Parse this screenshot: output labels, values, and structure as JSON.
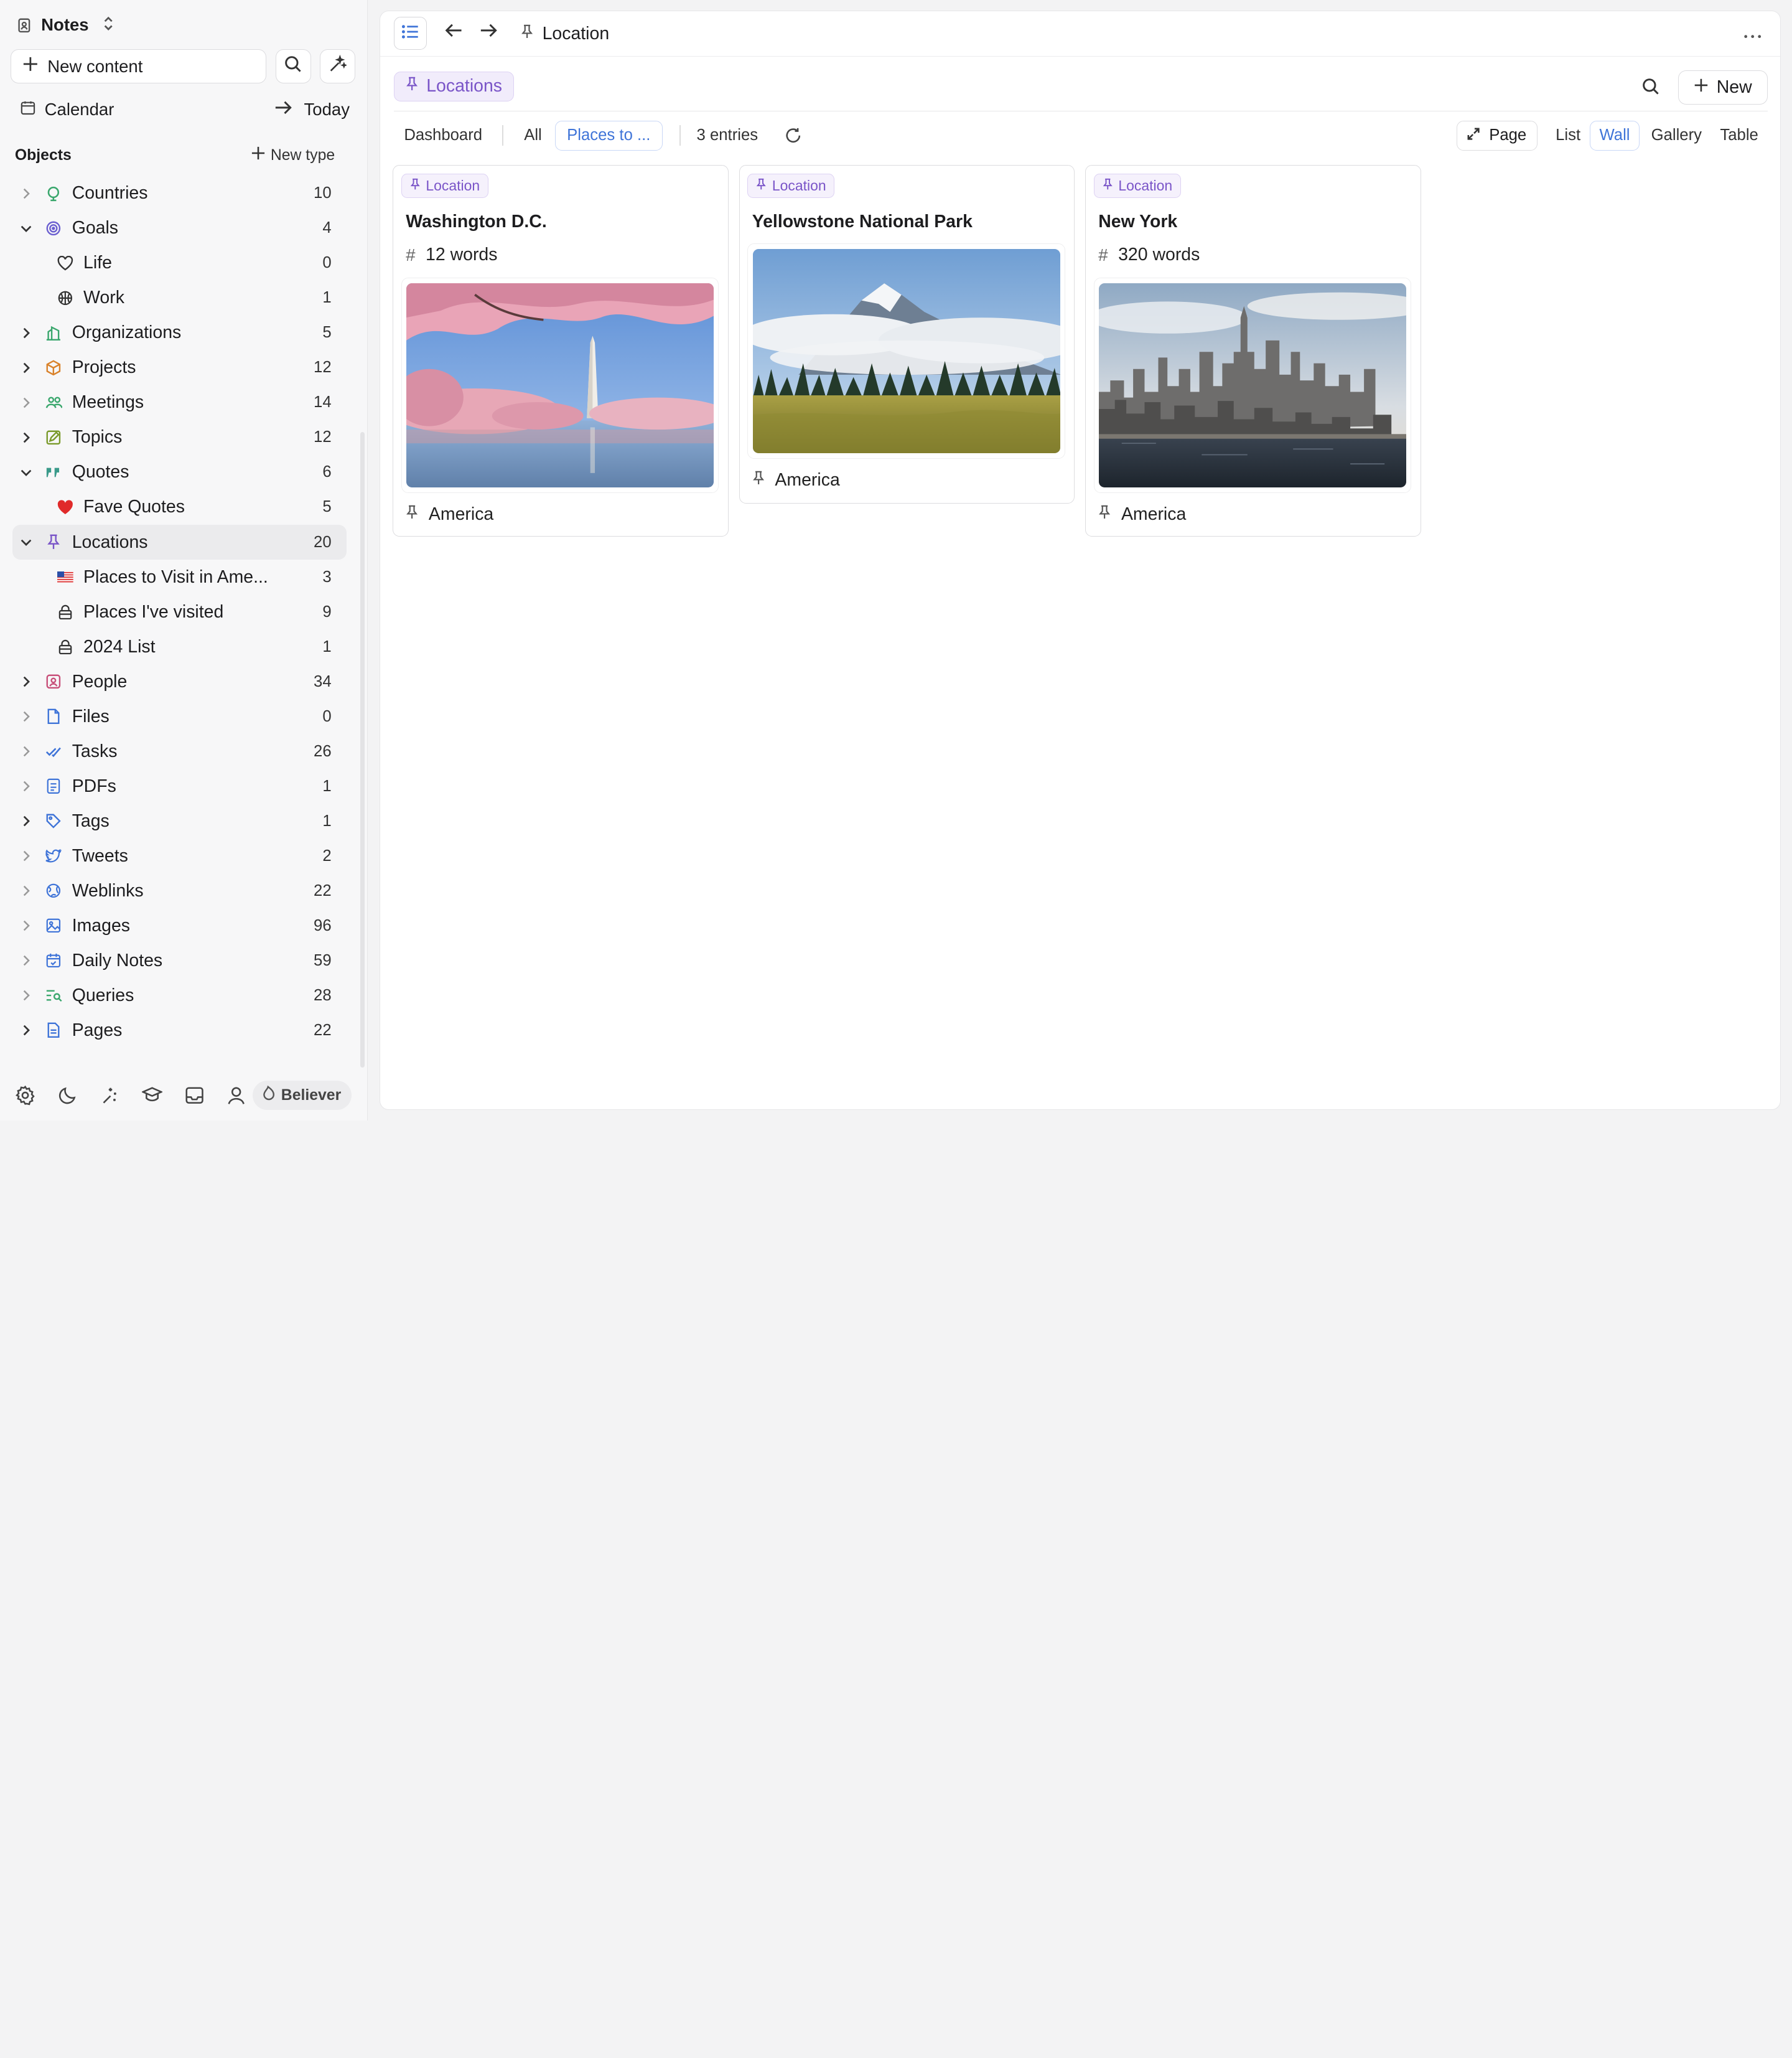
{
  "workspace": {
    "name": "Notes"
  },
  "sidebar": {
    "new_content": "New content",
    "calendar": "Calendar",
    "today": "Today",
    "objects_title": "Objects",
    "new_type": "New type",
    "items": [
      {
        "label": "Countries",
        "count": "10"
      },
      {
        "label": "Goals",
        "count": "4"
      },
      {
        "label": "Life",
        "count": "0"
      },
      {
        "label": "Work",
        "count": "1"
      },
      {
        "label": "Organizations",
        "count": "5"
      },
      {
        "label": "Projects",
        "count": "12"
      },
      {
        "label": "Meetings",
        "count": "14"
      },
      {
        "label": "Topics",
        "count": "12"
      },
      {
        "label": "Quotes",
        "count": "6"
      },
      {
        "label": "Fave Quotes",
        "count": "5"
      },
      {
        "label": "Locations",
        "count": "20"
      },
      {
        "label": "Places to Visit in Ame...",
        "count": "3"
      },
      {
        "label": "Places I've visited",
        "count": "9"
      },
      {
        "label": "2024 List",
        "count": "1"
      },
      {
        "label": "People",
        "count": "34"
      },
      {
        "label": "Files",
        "count": "0"
      },
      {
        "label": "Tasks",
        "count": "26"
      },
      {
        "label": "PDFs",
        "count": "1"
      },
      {
        "label": "Tags",
        "count": "1"
      },
      {
        "label": "Tweets",
        "count": "2"
      },
      {
        "label": "Weblinks",
        "count": "22"
      },
      {
        "label": "Images",
        "count": "96"
      },
      {
        "label": "Daily Notes",
        "count": "59"
      },
      {
        "label": "Queries",
        "count": "28"
      },
      {
        "label": "Pages",
        "count": "22"
      }
    ],
    "plan_badge": "Believer"
  },
  "topbar": {
    "breadcrumb": "Location"
  },
  "header": {
    "collection": "Locations",
    "new_label": "New"
  },
  "filters": {
    "dashboard": "Dashboard",
    "all": "All",
    "places": "Places to ...",
    "entries": "3 entries"
  },
  "views": {
    "page": "Page",
    "list": "List",
    "wall": "Wall",
    "gallery": "Gallery",
    "table": "Table"
  },
  "cards": [
    {
      "tag": "Location",
      "title": "Washington D.C.",
      "words": "12 words",
      "footer": "America"
    },
    {
      "tag": "Location",
      "title": "Yellowstone National Park",
      "words": "",
      "footer": "America"
    },
    {
      "tag": "Location",
      "title": "New York",
      "words": "320 words",
      "footer": "America"
    }
  ],
  "colors": {
    "accent_purple": "#7a55c8",
    "accent_blue": "#3f74d8"
  }
}
